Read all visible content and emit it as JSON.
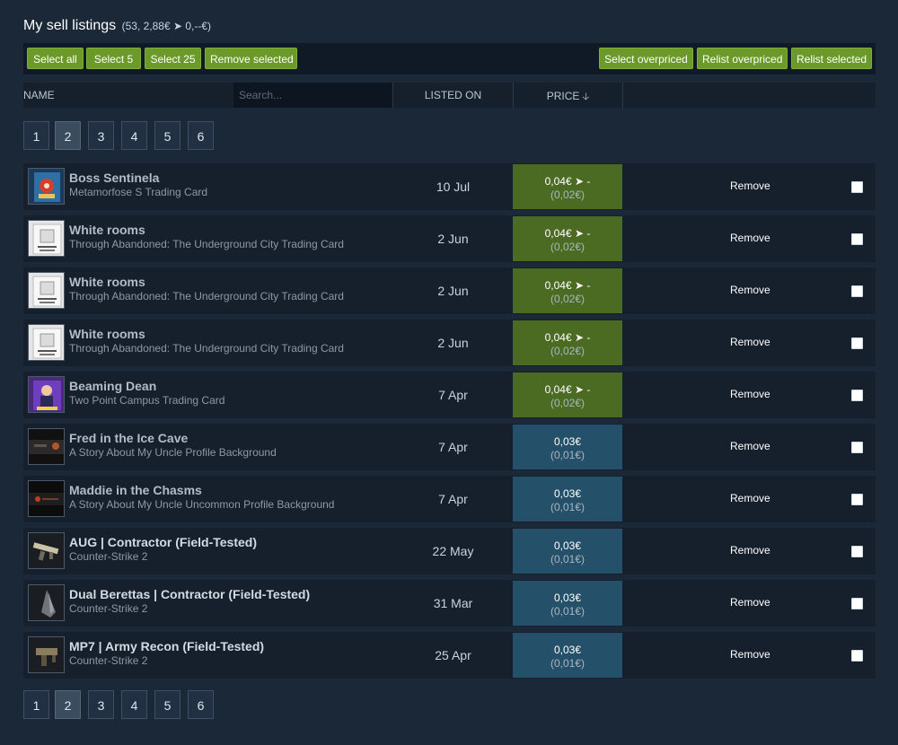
{
  "header": {
    "title": "My sell listings",
    "summary": "(53, 2,88€ ➤ 0,--€)"
  },
  "toolbar": {
    "select_all": "Select all",
    "select_5": "Select 5",
    "select_25": "Select 25",
    "remove_selected": "Remove selected",
    "select_overpriced": "Select overpriced",
    "relist_overpriced": "Relist overpriced",
    "relist_selected": "Relist selected"
  },
  "columns": {
    "name": "NAME",
    "search_placeholder": "Search...",
    "listed_on": "LISTED ON",
    "price": "PRICE",
    "price_sort_icon": "arrow-down"
  },
  "pagination": {
    "pages": [
      "1",
      "2",
      "3",
      "4",
      "5",
      "6"
    ],
    "current": "2"
  },
  "colors": {
    "button_green": "#6b9a2a",
    "price_green": "#4c6b22",
    "price_blue": "#25506a",
    "background": "#1b2838"
  },
  "listings": [
    {
      "name": "Boss Sentinela",
      "game": "Metamorfose S Trading Card",
      "date": "10 Jul",
      "price": "0,04€ ➤ -",
      "subprice": "(0,02€)",
      "price_state": "overpriced",
      "remove": "Remove",
      "thumb": "card-portrait"
    },
    {
      "name": "White rooms",
      "game": "Through Abandoned: The Underground City Trading Card",
      "date": "2 Jun",
      "price": "0,04€ ➤ -",
      "subprice": "(0,02€)",
      "price_state": "overpriced",
      "remove": "Remove",
      "thumb": "card-white"
    },
    {
      "name": "White rooms",
      "game": "Through Abandoned: The Underground City Trading Card",
      "date": "2 Jun",
      "price": "0,04€ ➤ -",
      "subprice": "(0,02€)",
      "price_state": "overpriced",
      "remove": "Remove",
      "thumb": "card-white"
    },
    {
      "name": "White rooms",
      "game": "Through Abandoned: The Underground City Trading Card",
      "date": "2 Jun",
      "price": "0,04€ ➤ -",
      "subprice": "(0,02€)",
      "price_state": "overpriced",
      "remove": "Remove",
      "thumb": "card-white"
    },
    {
      "name": "Beaming Dean",
      "game": "Two Point Campus Trading Card",
      "date": "7 Apr",
      "price": "0,04€ ➤ -",
      "subprice": "(0,02€)",
      "price_state": "overpriced",
      "remove": "Remove",
      "thumb": "card-purple"
    },
    {
      "name": "Fred in the Ice Cave",
      "game": "A Story About My Uncle Profile Background",
      "date": "7 Apr",
      "price": "0,03€",
      "subprice": "(0,01€)",
      "price_state": "ok",
      "remove": "Remove",
      "thumb": "background-dark"
    },
    {
      "name": "Maddie in the Chasms",
      "game": "A Story About My Uncle Uncommon Profile Background",
      "date": "7 Apr",
      "price": "0,03€",
      "subprice": "(0,01€)",
      "price_state": "ok",
      "remove": "Remove",
      "thumb": "background-dark-red"
    },
    {
      "name": "AUG | Contractor (Field-Tested)",
      "game": "Counter-Strike 2",
      "date": "22 May",
      "price": "0,03€",
      "subprice": "(0,01€)",
      "price_state": "ok",
      "remove": "Remove",
      "thumb": "rifle"
    },
    {
      "name": "Dual Berettas | Contractor (Field-Tested)",
      "game": "Counter-Strike 2",
      "date": "31 Mar",
      "price": "0,03€",
      "subprice": "(0,01€)",
      "price_state": "ok",
      "remove": "Remove",
      "thumb": "pistols"
    },
    {
      "name": "MP7 | Army Recon (Field-Tested)",
      "game": "Counter-Strike 2",
      "date": "25 Apr",
      "price": "0,03€",
      "subprice": "(0,01€)",
      "price_state": "ok",
      "remove": "Remove",
      "thumb": "smg"
    }
  ]
}
